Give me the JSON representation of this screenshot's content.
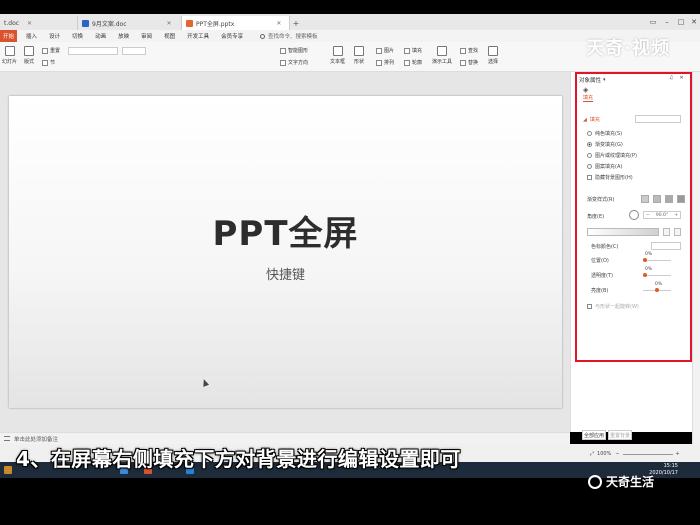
{
  "tabs": [
    {
      "label": "t.doc",
      "icon": "doc-icon",
      "color": "#d9532f",
      "active": false
    },
    {
      "label": "9月文案.doc",
      "icon": "word-icon",
      "color": "#2b66c7",
      "active": false
    },
    {
      "label": "PPT全屏.pptx",
      "icon": "ppt-icon",
      "color": "#e0672d",
      "active": true
    }
  ],
  "menu": {
    "items": [
      "开始",
      "插入",
      "设计",
      "切换",
      "动画",
      "放映",
      "审阅",
      "视图",
      "开发工具",
      "会员专享"
    ],
    "search": "查找命令、搜索模板"
  },
  "toolbar": {
    "buttons": [
      "幻灯片",
      "版式",
      "重置",
      "节",
      "文本框",
      "形状",
      "图片",
      "排列",
      "填充",
      "轮廓",
      "演示工具",
      "替换",
      "选择",
      "查找",
      "智能图形",
      "文字方向"
    ],
    "watermark": "天奇·视频"
  },
  "slide": {
    "title": "PPT全屏",
    "subtitle": "快捷键"
  },
  "notes": "单击此处添加备注",
  "panel": {
    "header": "对象属性",
    "tab": "填充",
    "section": "填充",
    "options": [
      "纯色填充(S)",
      "渐变填充(G)",
      "图片或纹理填充(P)",
      "图案填充(A)"
    ],
    "selected_option": "渐变填充(G)",
    "hide_bg": "隐藏背景图形(H)",
    "gradient_style": "渐变样式(R)",
    "angle_label": "角度(E)",
    "angle_value": "90.0°",
    "color_label": "色标颜色(C)",
    "position_label": "位置(O)",
    "position_value": "0%",
    "transparency_label": "透明度(T)",
    "transparency_value": "0%",
    "brightness_label": "亮度(B)",
    "brightness_value": "0%",
    "rotate_with_shape": "与形状一起旋转(W)",
    "apply_all": "全部应用",
    "reset_bg": "重置背景"
  },
  "zoom": "100%",
  "clock": {
    "time": "15:15",
    "date": "2020/10/17"
  },
  "caption": "4、在屏幕右侧填充下方对背景进行编辑设置即可",
  "brand": "天奇生活",
  "colors": {
    "accent": "#d9532f",
    "highlight": "#e0152b"
  }
}
